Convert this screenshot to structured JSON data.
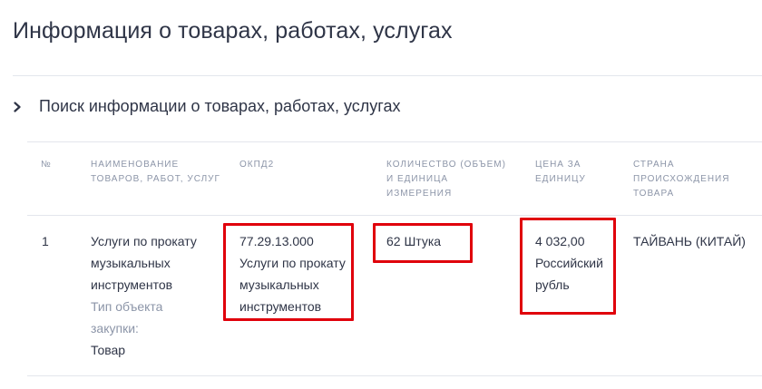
{
  "page": {
    "title": "Информация о товарах, работах, услугах"
  },
  "section": {
    "title": "Поиск информации о товарах, работах, услугах",
    "expand_icon": "chevron-right-icon"
  },
  "table": {
    "headers": {
      "num": "№",
      "name": [
        "НАИМЕНОВАНИЕ",
        "ТОВАРОВ, РАБОТ, УСЛУГ"
      ],
      "okpd2": "ОКПД2",
      "quantity": [
        "КОЛИЧЕСТВО (ОБЪЕМ)",
        "И ЕДИНИЦА",
        "ИЗМЕРЕНИЯ"
      ],
      "price": [
        "ЦЕНА ЗА",
        "ЕДИНИЦУ"
      ],
      "country": [
        "СТРАНА",
        "ПРОИСХОЖДЕНИЯ",
        "ТОВАРА"
      ]
    },
    "rows": [
      {
        "num": "1",
        "name": [
          "Услуги по прокату",
          "музыкальных",
          "инструментов"
        ],
        "object_type_label": [
          "Тип объекта",
          "закупки:"
        ],
        "object_type_value": "Товар",
        "okpd2_code": "77.29.13.000",
        "okpd2_name": [
          "Услуги по прокату",
          "музыкальных",
          "инструментов"
        ],
        "quantity": "62 Штука",
        "price_value": "4 032,00",
        "price_currency": [
          "Российский",
          "рубль"
        ],
        "country": "ТАЙВАНЬ (КИТАЙ)"
      }
    ]
  },
  "colors": {
    "text": "#2f3547",
    "muted": "#8c95a8",
    "divider": "#e3e6ec",
    "highlight": "#e0000b"
  }
}
